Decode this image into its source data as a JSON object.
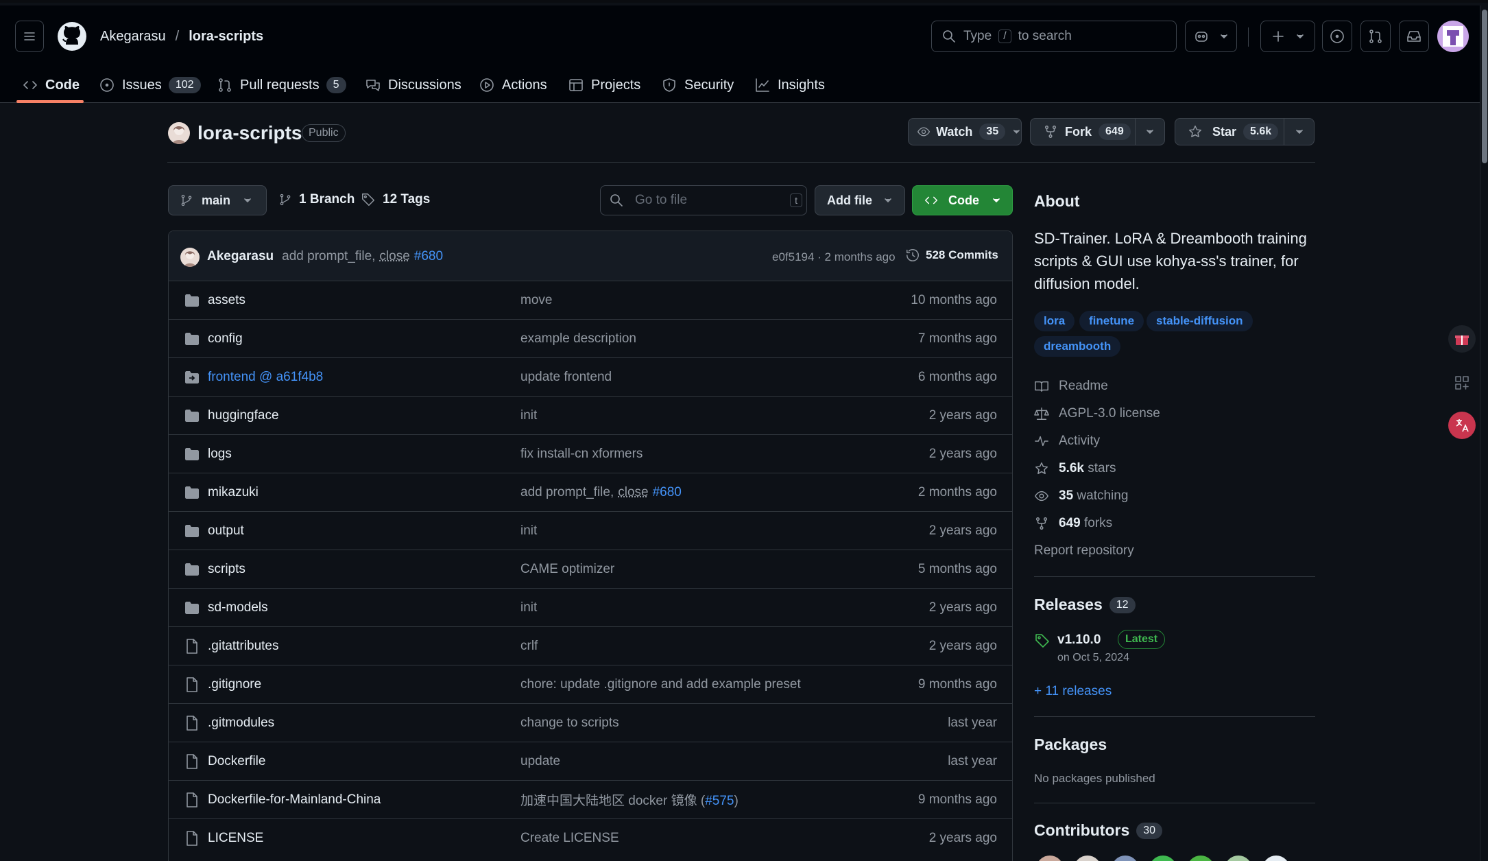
{
  "header": {
    "owner": "Akegarasu",
    "separator": "/",
    "repo": "lora-scripts",
    "search_pre": "Type",
    "search_key": "/",
    "search_post": "to search"
  },
  "tabs": [
    {
      "label": "Code"
    },
    {
      "label": "Issues",
      "count": "102"
    },
    {
      "label": "Pull requests",
      "count": "5"
    },
    {
      "label": "Discussions"
    },
    {
      "label": "Actions"
    },
    {
      "label": "Projects"
    },
    {
      "label": "Security"
    },
    {
      "label": "Insights"
    }
  ],
  "repo_head": {
    "name": "lora-scripts",
    "visibility": "Public",
    "watch_label": "Watch",
    "watch_count": "35",
    "fork_label": "Fork",
    "fork_count": "649",
    "star_label": "Star",
    "star_count": "5.6k"
  },
  "toolbar": {
    "branch": "main",
    "branches": "1 Branch",
    "tags": "12 Tags",
    "goto_placeholder": "Go to file",
    "goto_key": "t",
    "add_file": "Add file",
    "code": "Code"
  },
  "commit": {
    "author": "Akegarasu",
    "msg_pre": "add prompt_file,",
    "msg_close": "close",
    "msg_link": "#680",
    "hash_time": "e0f5194 · 2 months ago",
    "commits": "528 Commits"
  },
  "files": [
    {
      "type": "dir",
      "name": "assets",
      "msg": "move",
      "time": "10 months ago"
    },
    {
      "type": "dir",
      "name": "config",
      "msg": "example description",
      "time": "7 months ago"
    },
    {
      "type": "submodule",
      "name": "frontend @ a61f4b8",
      "msg": "update frontend",
      "time": "6 months ago"
    },
    {
      "type": "dir",
      "name": "huggingface",
      "msg": "init",
      "time": "2 years ago"
    },
    {
      "type": "dir",
      "name": "logs",
      "msg": "fix install-cn xformers",
      "time": "2 years ago"
    },
    {
      "type": "dir",
      "name": "mikazuki",
      "msg": "add prompt_file,",
      "msg_close": "close",
      "msg_link": "#680",
      "time": "2 months ago"
    },
    {
      "type": "dir",
      "name": "output",
      "msg": "init",
      "time": "2 years ago"
    },
    {
      "type": "dir",
      "name": "scripts",
      "msg": "CAME optimizer",
      "time": "5 months ago"
    },
    {
      "type": "dir",
      "name": "sd-models",
      "msg": "init",
      "time": "2 years ago"
    },
    {
      "type": "file",
      "name": ".gitattributes",
      "msg": "crlf",
      "time": "2 years ago"
    },
    {
      "type": "file",
      "name": ".gitignore",
      "msg": "chore: update .gitignore and add example preset",
      "time": "9 months ago"
    },
    {
      "type": "file",
      "name": ".gitmodules",
      "msg": "change to scripts",
      "time": "last year"
    },
    {
      "type": "file",
      "name": "Dockerfile",
      "msg": "update",
      "time": "last year"
    },
    {
      "type": "file",
      "name": "Dockerfile-for-Mainland-China",
      "msg": "加速中国大陆地区 docker 镜像 (",
      "msg_link": "#575",
      "msg_post": ")",
      "time": "9 months ago"
    },
    {
      "type": "file",
      "name": "LICENSE",
      "msg": "Create LICENSE",
      "time": "2 years ago"
    }
  ],
  "about": {
    "title": "About",
    "description": "SD-Trainer. LoRA & Dreambooth training scripts & GUI use kohya-ss's trainer, for diffusion model.",
    "topics": [
      "lora",
      "finetune",
      "stable-diffusion",
      "dreambooth"
    ],
    "readme": "Readme",
    "license": "AGPL-3.0 license",
    "activity": "Activity",
    "stars_num": "5.6k",
    "stars_word": "stars",
    "watching_num": "35",
    "watching_word": "watching",
    "forks_num": "649",
    "forks_word": "forks",
    "report": "Report repository"
  },
  "releases": {
    "title": "Releases",
    "count": "12",
    "version": "v1.10.0",
    "badge": "Latest",
    "date": "on Oct 5, 2024",
    "more": "+ 11 releases"
  },
  "packages": {
    "title": "Packages",
    "text": "No packages published"
  },
  "contributors": {
    "title": "Contributors",
    "count": "30"
  },
  "colors": {
    "accent": "#4493f8",
    "green": "#238636",
    "tab_underline": "#f78166"
  }
}
